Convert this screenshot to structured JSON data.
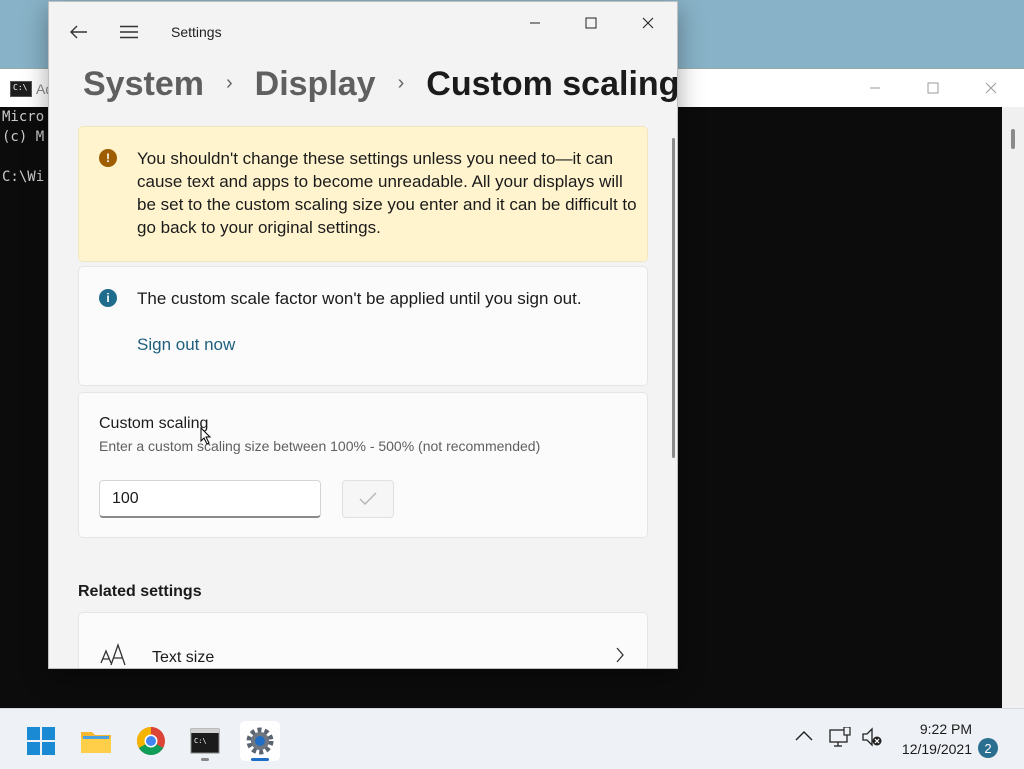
{
  "cmd": {
    "title": "Ad",
    "lines": [
      "Micro",
      "(c) M",
      "",
      "C:\\Wi"
    ]
  },
  "settings": {
    "title": "Settings",
    "breadcrumb": {
      "item1": "System",
      "item2": "Display",
      "current": "Custom scaling"
    },
    "warning": {
      "text": "You shouldn't change these settings unless you need to—it can cause text and apps to become unreadable. All your displays will be set to the custom scaling size you enter and it can be difficult to go back to your original settings."
    },
    "info": {
      "text": "The custom scale factor won't be applied until you sign out.",
      "link": "Sign out now"
    },
    "custom_scaling": {
      "title": "Custom scaling",
      "subtitle": "Enter a custom scaling size between 100% - 500% (not recommended)",
      "value": "100"
    },
    "related_heading": "Related settings",
    "text_size_label": "Text size"
  },
  "taskbar": {
    "clock_time": "9:22 PM",
    "clock_date": "12/19/2021",
    "notification_count": "2"
  },
  "colors": {
    "warning_bg": "#fff4ce",
    "warning_icon": "#9d5d00",
    "info_icon": "#1f6c8d",
    "link": "#1f5f7c"
  }
}
